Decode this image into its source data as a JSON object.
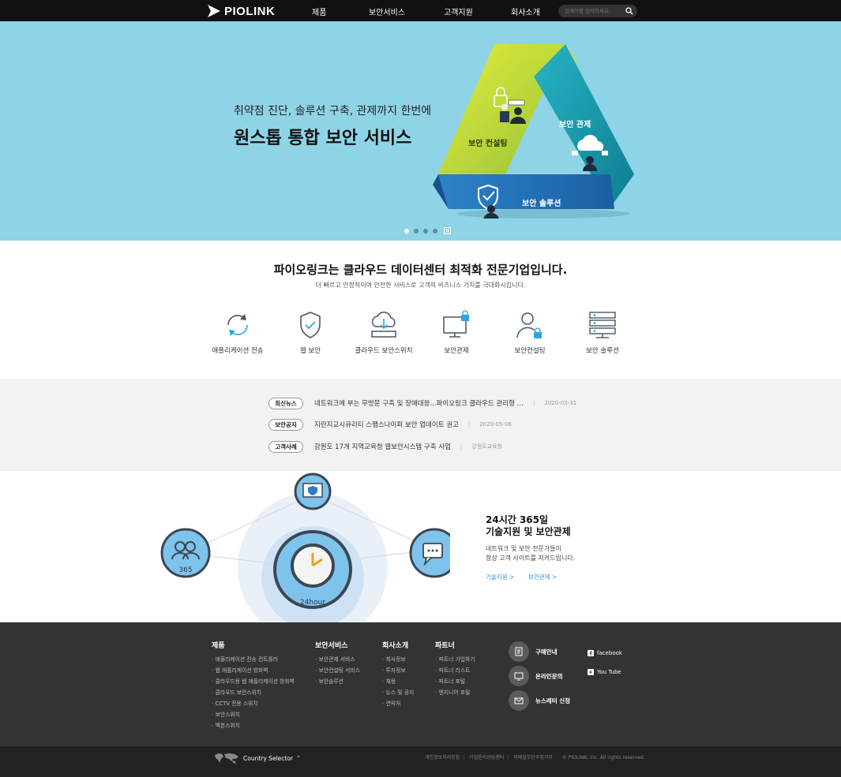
{
  "header": {
    "logo": "PIOLINK",
    "nav": [
      "제품",
      "보안서비스",
      "고객지원",
      "회사소개"
    ],
    "search_placeholder": "검색어를 입력하세요."
  },
  "hero": {
    "subtitle": "취약점 진단, 솔루션 구축, 관제까지 한번에",
    "title": "원스톱 통합 보안 서비스",
    "segments": [
      "보안 컨설팅",
      "보안 관제",
      "보안 솔루션"
    ],
    "slide_count": 4,
    "active_slide": 1
  },
  "intro": {
    "title": "파이오링크는 클라우드 데이터센터 최적화 전문기업입니다.",
    "desc": "더 빠르고 안정적이며 안전한 서비스로 고객의 비즈니스 가치를 극대화시킵니다."
  },
  "services": [
    {
      "label": "애플리케이션 전송",
      "icon": "sync-icon"
    },
    {
      "label": "웹 보안",
      "icon": "shield-check-icon"
    },
    {
      "label": "클라우드 보안스위치",
      "icon": "cloud-download-icon"
    },
    {
      "label": "보안관제",
      "icon": "monitor-lock-icon"
    },
    {
      "label": "보안컨설팅",
      "icon": "user-lock-icon"
    },
    {
      "label": "보안 솔루션",
      "icon": "server-rack-icon"
    }
  ],
  "news": [
    {
      "badge": "최신뉴스",
      "text": "네트워크에 부는 무방문 구축 및 장애대응...파이오링크 클라우드 관리형 …",
      "meta": "2020-03-31"
    },
    {
      "badge": "보안공지",
      "text": "지란지교시큐리티 스팸스나이퍼 보안 업데이트 권고",
      "meta": "2020-05-06"
    },
    {
      "badge": "고객사례",
      "text": "강원도 17개 지역교육청 웹보안시스템 구축 사업",
      "meta": "강원도교육청"
    }
  ],
  "support": {
    "title_line1": "24시간 365일",
    "title_line2": "기술지원 및 보안관제",
    "desc_line1": "네트워크 및 보안 전문가들이",
    "desc_line2": "항상 고객 사이트를 지켜드립니다.",
    "link1": "기술지원 >",
    "link2": "보안관제 >",
    "label_365": "365",
    "label_24": "24hour"
  },
  "footer": {
    "columns": [
      {
        "title": "제품",
        "items": [
          "애플리케이션 전송 컨트롤러",
          "웹 애플리케이션 방화벽",
          "클라우드용 웹 애플리케이션 방화벽",
          "클라우드 보안스위치",
          "CCTV 전용 스위치",
          "보안스위치",
          "백본스위치"
        ]
      },
      {
        "title": "보안서비스",
        "items": [
          "보안관제 서비스",
          "보안컨설팅 서비스",
          "보안솔루션"
        ]
      },
      {
        "title": "회사소개",
        "items": [
          "회사정보",
          "투자정보",
          "채용",
          "뉴스 및 공지",
          "연락처"
        ]
      },
      {
        "title": "파트너",
        "items": [
          "파트너 가입하기",
          "파트너 리스트",
          "파트너 포털",
          "엔지니어 포털"
        ]
      }
    ],
    "contacts": [
      "구매안내",
      "온라인문의",
      "뉴스레터 신청"
    ],
    "social": [
      "facebook",
      "You Tube"
    ],
    "country_selector": "Country Selector",
    "bottom_links": [
      "개인정보처리방침",
      "기업윤리상담센터",
      "이메일무단수집거부"
    ],
    "copyright": "© PIOLINK, Inc. All rights reserved."
  }
}
